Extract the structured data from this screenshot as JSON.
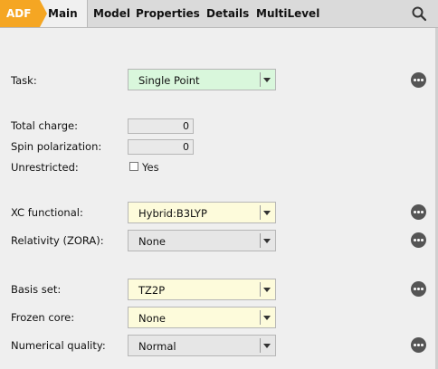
{
  "tabs": {
    "adf": "ADF",
    "main": "Main",
    "model": "Model",
    "properties": "Properties",
    "details": "Details",
    "multilevel": "MultiLevel"
  },
  "icons": {
    "search": "search-icon",
    "more": "more-options-icon"
  },
  "colors": {
    "adf_tab": "#f5a623",
    "green_field": "#d9f7dc",
    "yellow_field": "#fdfbdb"
  },
  "form": {
    "task": {
      "label": "Task:",
      "value": "Single Point"
    },
    "total_charge": {
      "label": "Total charge:",
      "value": "0"
    },
    "spin_polarization": {
      "label": "Spin polarization:",
      "value": "0"
    },
    "unrestricted": {
      "label": "Unrestricted:",
      "option": "Yes",
      "checked": false
    },
    "xc_functional": {
      "label": "XC functional:",
      "value": "Hybrid:B3LYP"
    },
    "relativity": {
      "label": "Relativity (ZORA):",
      "value": "None"
    },
    "basis_set": {
      "label": "Basis set:",
      "value": "TZ2P"
    },
    "frozen_core": {
      "label": "Frozen core:",
      "value": "None"
    },
    "numerical_quality": {
      "label": "Numerical quality:",
      "value": "Normal"
    }
  }
}
